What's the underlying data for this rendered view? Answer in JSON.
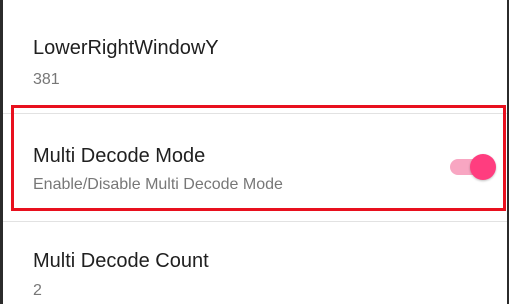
{
  "preferences": [
    {
      "title": "LowerRightWindowY",
      "summary": "381"
    },
    {
      "title": "Multi Decode Mode",
      "summary": "Enable/Disable Multi Decode Mode",
      "toggle": {
        "checked": true
      }
    },
    {
      "title": "Multi Decode Count",
      "summary": "2"
    }
  ],
  "colors": {
    "accent": "#ff3d7f",
    "track_on": "#f8a6c2",
    "highlight_border": "#e8101e"
  }
}
